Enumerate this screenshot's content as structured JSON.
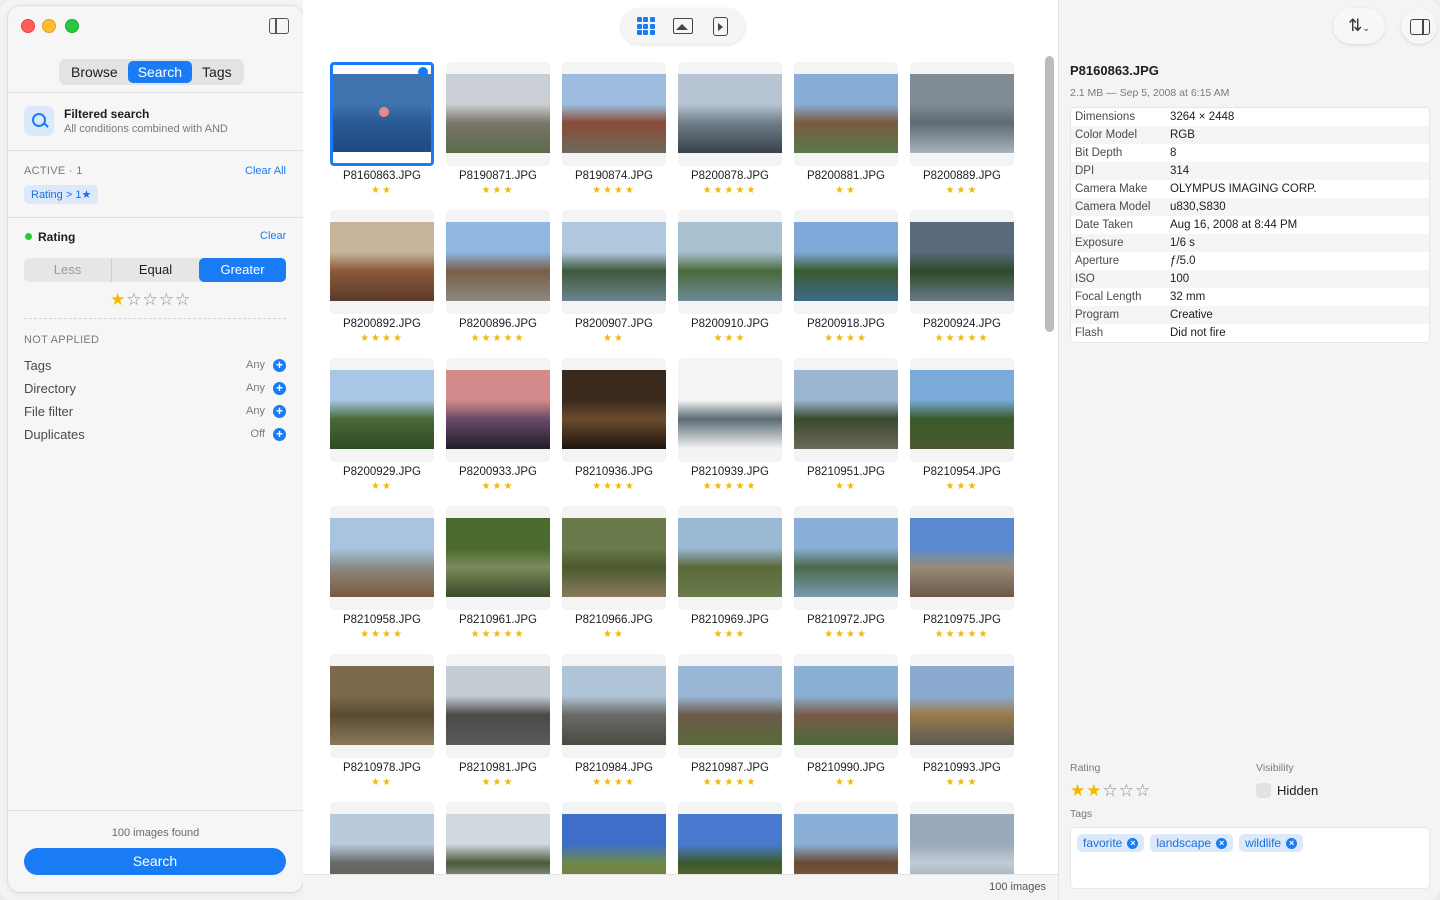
{
  "sidebar": {
    "tabs": [
      "Browse",
      "Search",
      "Tags"
    ],
    "active_tab": 1,
    "filter_title": "Filtered search",
    "filter_subtitle": "All conditions combined with AND",
    "active_label": "ACTIVE · 1",
    "clear_all": "Clear All",
    "active_chip": "Rating > 1★",
    "rating_label": "Rating",
    "rating_clear": "Clear",
    "compare_options": [
      "Less",
      "Equal",
      "Greater"
    ],
    "compare_selected": 2,
    "rating_value": 1,
    "not_applied_label": "NOT APPLIED",
    "not_applied": [
      {
        "label": "Tags",
        "value": "Any"
      },
      {
        "label": "Directory",
        "value": "Any"
      },
      {
        "label": "File filter",
        "value": "Any"
      },
      {
        "label": "Duplicates",
        "value": "Off"
      }
    ],
    "found_text": "100 images found",
    "search_button": "Search"
  },
  "grid": {
    "items": [
      {
        "name": "P8160863.JPG",
        "rating": 2,
        "colors": [
          "#3f73b0",
          "#2a5a96",
          "#1f4a82"
        ],
        "selected": true
      },
      {
        "name": "P8190871.JPG",
        "rating": 3,
        "colors": [
          "#c9cfd4",
          "#7a7669",
          "#5b6b4a"
        ]
      },
      {
        "name": "P8190874.JPG",
        "rating": 4,
        "colors": [
          "#9cbde0",
          "#8a4a38",
          "#6d6a5c"
        ]
      },
      {
        "name": "P8200878.JPG",
        "rating": 5,
        "colors": [
          "#b7c5d3",
          "#6f7d88",
          "#39414a"
        ]
      },
      {
        "name": "P8200881.JPG",
        "rating": 2,
        "colors": [
          "#89aed6",
          "#7a5a3e",
          "#5a7a4a"
        ]
      },
      {
        "name": "P8200889.JPG",
        "rating": 3,
        "colors": [
          "#7f8c96",
          "#5e6b76",
          "#a8b3ba"
        ]
      },
      {
        "name": "P8200892.JPG",
        "rating": 4,
        "colors": [
          "#c8b49a",
          "#8a5a3a",
          "#5a3a2a"
        ]
      },
      {
        "name": "P8200896.JPG",
        "rating": 5,
        "colors": [
          "#8fb7e0",
          "#7a5e48",
          "#8a8a82"
        ]
      },
      {
        "name": "P8200907.JPG",
        "rating": 2,
        "colors": [
          "#b0c7dd",
          "#3e5a3a",
          "#6d8290"
        ]
      },
      {
        "name": "P8200910.JPG",
        "rating": 3,
        "colors": [
          "#a8c0d0",
          "#4a6a3a",
          "#6a8a9a"
        ]
      },
      {
        "name": "P8200918.JPG",
        "rating": 4,
        "colors": [
          "#7ea9d8",
          "#3a5a2e",
          "#3e6a8a"
        ]
      },
      {
        "name": "P8200924.JPG",
        "rating": 5,
        "colors": [
          "#5a6a7a",
          "#2e4a2a",
          "#6a7a86"
        ]
      },
      {
        "name": "P8200929.JPG",
        "rating": 2,
        "colors": [
          "#a9c6e6",
          "#4a6a3a",
          "#2e4a22"
        ]
      },
      {
        "name": "P8200933.JPG",
        "rating": 3,
        "colors": [
          "#d48a8a",
          "#6a4a6a",
          "#1e1e2a"
        ]
      },
      {
        "name": "P8210936.JPG",
        "rating": 4,
        "colors": [
          "#3a2a1e",
          "#6a4a2e",
          "#1e1610"
        ]
      },
      {
        "name": "P8210939.JPG",
        "rating": 5,
        "colors": [
          "#f4f4f4",
          "#5a6a74",
          "#f4f4f4"
        ]
      },
      {
        "name": "P8210951.JPG",
        "rating": 2,
        "colors": [
          "#9ab6d0",
          "#3a4a2e",
          "#6a6a5a"
        ]
      },
      {
        "name": "P8210954.JPG",
        "rating": 3,
        "colors": [
          "#7aaad8",
          "#3a5a2a",
          "#4a5a2e"
        ]
      },
      {
        "name": "P8210958.JPG",
        "rating": 4,
        "colors": [
          "#a8c4e0",
          "#8a8a86",
          "#7a5a3a"
        ]
      },
      {
        "name": "P8210961.JPG",
        "rating": 5,
        "colors": [
          "#4a6a2e",
          "#7a8a5a",
          "#3a4a2a"
        ]
      },
      {
        "name": "P8210966.JPG",
        "rating": 2,
        "colors": [
          "#6a7a4a",
          "#4a5a2e",
          "#8a7a5a"
        ]
      },
      {
        "name": "P8210969.JPG",
        "rating": 3,
        "colors": [
          "#9ab8d4",
          "#5a6a3a",
          "#6a7a4a"
        ]
      },
      {
        "name": "P8210972.JPG",
        "rating": 4,
        "colors": [
          "#8ab0d8",
          "#4a6a4a",
          "#7a9ab0"
        ]
      },
      {
        "name": "P8210975.JPG",
        "rating": 5,
        "colors": [
          "#5a8ad0",
          "#9a8a7a",
          "#6a5a4a"
        ]
      },
      {
        "name": "P8210978.JPG",
        "rating": 2,
        "colors": [
          "#7a6a4a",
          "#5a4a32",
          "#8a7a5a"
        ]
      },
      {
        "name": "P8210981.JPG",
        "rating": 3,
        "colors": [
          "#c4ccd4",
          "#4a4a48",
          "#5a5a58"
        ]
      },
      {
        "name": "P8210984.JPG",
        "rating": 4,
        "colors": [
          "#b0c4d8",
          "#6a6a66",
          "#4a4a44"
        ]
      },
      {
        "name": "P8210987.JPG",
        "rating": 5,
        "colors": [
          "#9ab6d6",
          "#6a5a4a",
          "#5a6a3a"
        ]
      },
      {
        "name": "P8210990.JPG",
        "rating": 2,
        "colors": [
          "#8ab0d4",
          "#7a5a48",
          "#4a6a3a"
        ]
      },
      {
        "name": "P8210993.JPG",
        "rating": 3,
        "colors": [
          "#8aaad0",
          "#9a7a4a",
          "#5a5a52"
        ]
      },
      {
        "name": "",
        "rating": 0,
        "colors": [
          "#b8cadc",
          "#6a6a66",
          "#5a5a50"
        ]
      },
      {
        "name": "",
        "rating": 0,
        "colors": [
          "#d0d8e0",
          "#4a5a3a",
          "#c8d0d8"
        ]
      },
      {
        "name": "",
        "rating": 0,
        "colors": [
          "#3e6ec8",
          "#6a8a4a",
          "#8a6a3a"
        ]
      },
      {
        "name": "",
        "rating": 0,
        "colors": [
          "#4a7ad0",
          "#3a5a2a",
          "#8a6a3a"
        ]
      },
      {
        "name": "",
        "rating": 0,
        "colors": [
          "#8ab0d8",
          "#6a4a32",
          "#7a6a5a"
        ]
      },
      {
        "name": "",
        "rating": 0,
        "colors": [
          "#9aaaba",
          "#c0ccd4",
          "#8a9aa8"
        ]
      }
    ]
  },
  "status": {
    "count": "100 images"
  },
  "inspector": {
    "filename": "P8160863.JPG",
    "subtitle": "2.1 MB — Sep 5, 2008 at 6:15 AM",
    "metadata": [
      {
        "key": "Dimensions",
        "value": "3264 × 2448"
      },
      {
        "key": "Color Model",
        "value": "RGB"
      },
      {
        "key": "Bit Depth",
        "value": "8"
      },
      {
        "key": "DPI",
        "value": "314"
      },
      {
        "key": "Camera Make",
        "value": "OLYMPUS IMAGING CORP."
      },
      {
        "key": "Camera Model",
        "value": "u830,S830"
      },
      {
        "key": "Date Taken",
        "value": "Aug 16, 2008 at 8:44 PM"
      },
      {
        "key": "Exposure",
        "value": "1/6 s"
      },
      {
        "key": "Aperture",
        "value": "ƒ/5.0"
      },
      {
        "key": "ISO",
        "value": "100"
      },
      {
        "key": "Focal Length",
        "value": "32 mm"
      },
      {
        "key": "Program",
        "value": "Creative"
      },
      {
        "key": "Flash",
        "value": "Did not fire"
      }
    ],
    "rating_label": "Rating",
    "rating_value": 2,
    "visibility_label": "Visibility",
    "hidden_label": "Hidden",
    "tags_label": "Tags",
    "tags": [
      "favorite",
      "landscape",
      "wildlife"
    ]
  },
  "colors": {
    "accent": "#1a7cf5",
    "star": "#f5b800"
  }
}
